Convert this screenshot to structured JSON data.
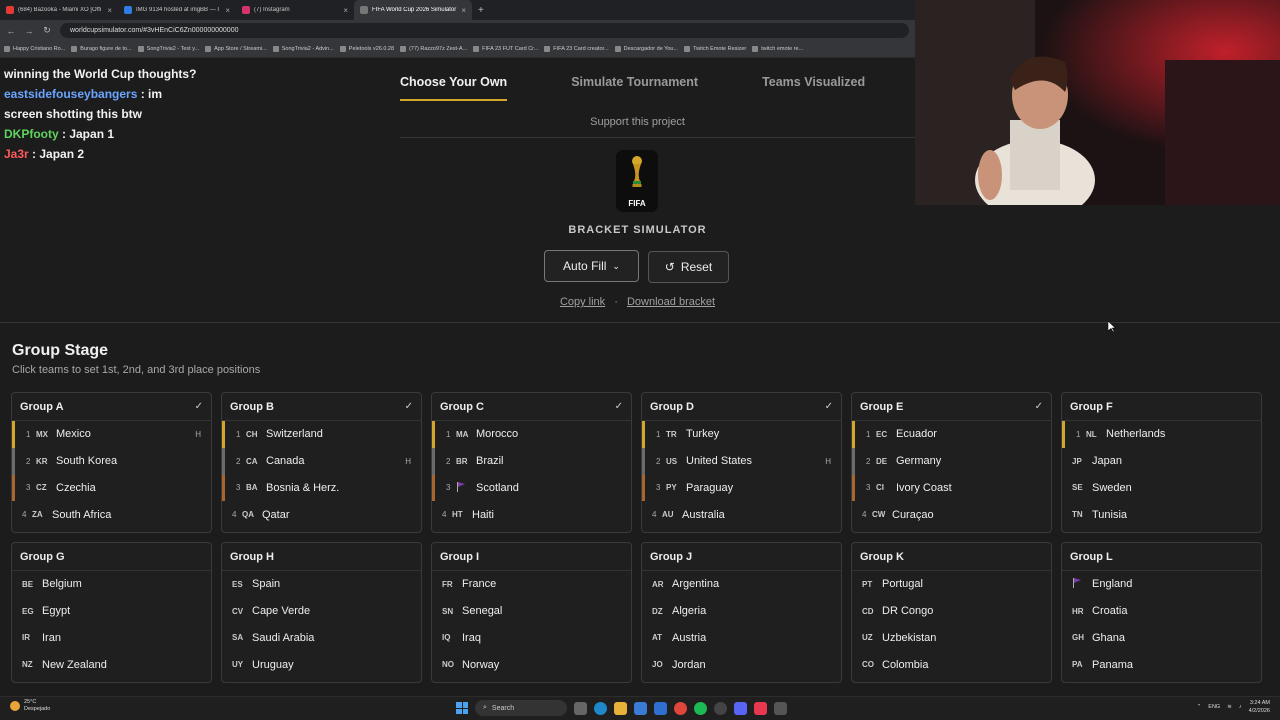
{
  "browser": {
    "tabs": [
      {
        "title": "(684) Bazooka - Miami XO [Offi",
        "color": "#e53935",
        "active": false
      },
      {
        "title": "IMG 9134 hosted at imgBB — I",
        "color": "#2f7de1",
        "active": false
      },
      {
        "title": "(7) Instagram",
        "color": "#d6336c",
        "active": false
      },
      {
        "title": "FIFA World Cup 2026 Simulator",
        "color": "#777777",
        "active": true
      }
    ],
    "url": "worldcupsimulator.com/#3vHEnCiC6Zn000000000000",
    "bookmarks": [
      "Happy Cristiano Ro...",
      "Burago figure de to...",
      "SongTrivia2 - Test y...",
      "App Store / Streami...",
      "SongTrivia2 - Advin...",
      "Peletools v26.0.28",
      "(77) Razzo97z Zest-A...",
      "FIFA 23 FUT Card Cr...",
      "FIFA 23 Card creator...",
      "Descargador de You...",
      "Twitch Emote Resizer",
      "twitch emote re..."
    ]
  },
  "chat": [
    {
      "user": "",
      "user_color": "#ffffff",
      "text": "winning the World Cup thoughts?"
    },
    {
      "user": "eastsidefouseybangers",
      "user_color": "#6aa6ff",
      "text": " : im"
    },
    {
      "user": "",
      "user_color": "#ffffff",
      "text": "screen shotting this btw"
    },
    {
      "user": "DKPfooty",
      "user_color": "#5fd35f",
      "text": " : Japan 1"
    },
    {
      "user": "Ja3r",
      "user_color": "#ff5a5a",
      "text": " : Japan 2"
    }
  ],
  "nav": {
    "items": [
      "Choose Your Own",
      "Simulate Tournament",
      "Teams Visualized"
    ],
    "active_index": 0
  },
  "support_text": "Support this project",
  "logo_text": "FIFA",
  "bracket_title": "BRACKET SIMULATOR",
  "buttons": {
    "auto_fill": "Auto Fill",
    "reset": "Reset"
  },
  "links": {
    "copy": "Copy link",
    "separator": "·",
    "download": "Download bracket"
  },
  "group_stage": {
    "title": "Group Stage",
    "subtitle": "Click teams to set 1st, 2nd, and 3rd place positions",
    "groups": [
      {
        "name": "Group A",
        "check": "✓",
        "teams": [
          {
            "rank": "1",
            "code": "MX",
            "name": "Mexico",
            "host": "H",
            "pos": "p1"
          },
          {
            "rank": "2",
            "code": "KR",
            "name": "South Korea",
            "host": "",
            "pos": "p2"
          },
          {
            "rank": "3",
            "code": "CZ",
            "name": "Czechia",
            "host": "",
            "pos": "p3"
          },
          {
            "rank": "4",
            "code": "ZA",
            "name": "South Africa",
            "host": "",
            "pos": ""
          }
        ]
      },
      {
        "name": "Group B",
        "check": "✓",
        "teams": [
          {
            "rank": "1",
            "code": "CH",
            "name": "Switzerland",
            "host": "",
            "pos": "p1"
          },
          {
            "rank": "2",
            "code": "CA",
            "name": "Canada",
            "host": "H",
            "pos": "p2"
          },
          {
            "rank": "3",
            "code": "BA",
            "name": "Bosnia & Herz.",
            "host": "",
            "pos": "p3"
          },
          {
            "rank": "4",
            "code": "QA",
            "name": "Qatar",
            "host": "",
            "pos": ""
          }
        ]
      },
      {
        "name": "Group C",
        "check": "✓",
        "teams": [
          {
            "rank": "1",
            "code": "MA",
            "name": "Morocco",
            "host": "",
            "pos": "p1"
          },
          {
            "rank": "2",
            "code": "BR",
            "name": "Brazil",
            "host": "",
            "pos": "p2"
          },
          {
            "rank": "3",
            "code": "",
            "name": "Scotland",
            "host": "",
            "pos": "p3",
            "flag": true
          },
          {
            "rank": "4",
            "code": "HT",
            "name": "Haiti",
            "host": "",
            "pos": ""
          }
        ]
      },
      {
        "name": "Group D",
        "check": "✓",
        "teams": [
          {
            "rank": "1",
            "code": "TR",
            "name": "Turkey",
            "host": "",
            "pos": "p1"
          },
          {
            "rank": "2",
            "code": "US",
            "name": "United States",
            "host": "H",
            "pos": "p2"
          },
          {
            "rank": "3",
            "code": "PY",
            "name": "Paraguay",
            "host": "",
            "pos": "p3"
          },
          {
            "rank": "4",
            "code": "AU",
            "name": "Australia",
            "host": "",
            "pos": ""
          }
        ]
      },
      {
        "name": "Group E",
        "check": "✓",
        "teams": [
          {
            "rank": "1",
            "code": "EC",
            "name": "Ecuador",
            "host": "",
            "pos": "p1"
          },
          {
            "rank": "2",
            "code": "DE",
            "name": "Germany",
            "host": "",
            "pos": "p2"
          },
          {
            "rank": "3",
            "code": "CI",
            "name": "Ivory Coast",
            "host": "",
            "pos": "p3"
          },
          {
            "rank": "4",
            "code": "CW",
            "name": "Curaçao",
            "host": "",
            "pos": ""
          }
        ]
      },
      {
        "name": "Group F",
        "check": "",
        "teams": [
          {
            "rank": "1",
            "code": "NL",
            "name": "Netherlands",
            "host": "",
            "pos": "p1"
          },
          {
            "rank": "",
            "code": "JP",
            "name": "Japan",
            "host": "",
            "pos": ""
          },
          {
            "rank": "",
            "code": "SE",
            "name": "Sweden",
            "host": "",
            "pos": ""
          },
          {
            "rank": "",
            "code": "TN",
            "name": "Tunisia",
            "host": "",
            "pos": ""
          }
        ]
      },
      {
        "name": "Group G",
        "check": "",
        "teams": [
          {
            "rank": "",
            "code": "BE",
            "name": "Belgium",
            "host": "",
            "pos": ""
          },
          {
            "rank": "",
            "code": "EG",
            "name": "Egypt",
            "host": "",
            "pos": ""
          },
          {
            "rank": "",
            "code": "IR",
            "name": "Iran",
            "host": "",
            "pos": ""
          },
          {
            "rank": "",
            "code": "NZ",
            "name": "New Zealand",
            "host": "",
            "pos": ""
          }
        ]
      },
      {
        "name": "Group H",
        "check": "",
        "teams": [
          {
            "rank": "",
            "code": "ES",
            "name": "Spain",
            "host": "",
            "pos": ""
          },
          {
            "rank": "",
            "code": "CV",
            "name": "Cape Verde",
            "host": "",
            "pos": ""
          },
          {
            "rank": "",
            "code": "SA",
            "name": "Saudi Arabia",
            "host": "",
            "pos": ""
          },
          {
            "rank": "",
            "code": "UY",
            "name": "Uruguay",
            "host": "",
            "pos": ""
          }
        ]
      },
      {
        "name": "Group I",
        "check": "",
        "teams": [
          {
            "rank": "",
            "code": "FR",
            "name": "France",
            "host": "",
            "pos": ""
          },
          {
            "rank": "",
            "code": "SN",
            "name": "Senegal",
            "host": "",
            "pos": ""
          },
          {
            "rank": "",
            "code": "IQ",
            "name": "Iraq",
            "host": "",
            "pos": ""
          },
          {
            "rank": "",
            "code": "NO",
            "name": "Norway",
            "host": "",
            "pos": ""
          }
        ]
      },
      {
        "name": "Group J",
        "check": "",
        "teams": [
          {
            "rank": "",
            "code": "AR",
            "name": "Argentina",
            "host": "",
            "pos": ""
          },
          {
            "rank": "",
            "code": "DZ",
            "name": "Algeria",
            "host": "",
            "pos": ""
          },
          {
            "rank": "",
            "code": "AT",
            "name": "Austria",
            "host": "",
            "pos": ""
          },
          {
            "rank": "",
            "code": "JO",
            "name": "Jordan",
            "host": "",
            "pos": ""
          }
        ]
      },
      {
        "name": "Group K",
        "check": "",
        "teams": [
          {
            "rank": "",
            "code": "PT",
            "name": "Portugal",
            "host": "",
            "pos": ""
          },
          {
            "rank": "",
            "code": "CD",
            "name": "DR Congo",
            "host": "",
            "pos": ""
          },
          {
            "rank": "",
            "code": "UZ",
            "name": "Uzbekistan",
            "host": "",
            "pos": ""
          },
          {
            "rank": "",
            "code": "CO",
            "name": "Colombia",
            "host": "",
            "pos": ""
          }
        ]
      },
      {
        "name": "Group L",
        "check": "",
        "teams": [
          {
            "rank": "",
            "code": "",
            "name": "England",
            "host": "",
            "pos": "",
            "flag": true
          },
          {
            "rank": "",
            "code": "HR",
            "name": "Croatia",
            "host": "",
            "pos": ""
          },
          {
            "rank": "",
            "code": "GH",
            "name": "Ghana",
            "host": "",
            "pos": ""
          },
          {
            "rank": "",
            "code": "PA",
            "name": "Panama",
            "host": "",
            "pos": ""
          }
        ]
      }
    ]
  },
  "taskbar": {
    "weather_temp": "25°C",
    "weather_desc": "Despejado",
    "search_label": "Search",
    "lang": "ENG",
    "time": "3:24 AM",
    "date": "4/2/2026"
  },
  "colors": {
    "accent_gold": "#d4a62a",
    "second": "#6b6b6b",
    "third": "#a8662e"
  }
}
